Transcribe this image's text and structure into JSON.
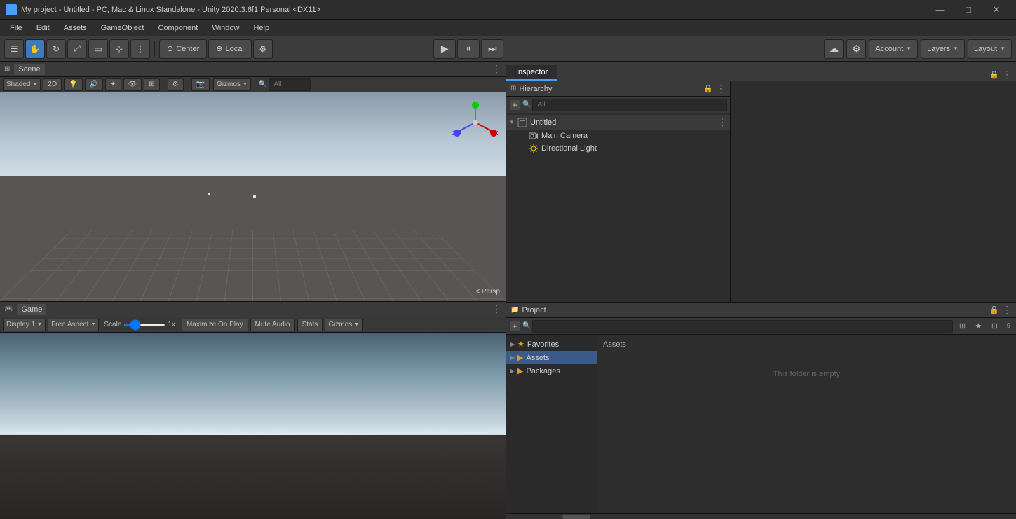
{
  "titlebar": {
    "title": "My project - Untitled - PC, Mac & Linux Standalone - Unity 2020.3.6f1 Personal <DX11>",
    "minimize": "—",
    "maximize": "□",
    "close": "✕"
  },
  "menubar": {
    "items": [
      "File",
      "Edit",
      "Assets",
      "GameObject",
      "Component",
      "Window",
      "Help"
    ]
  },
  "toolbar": {
    "tools": [
      "☰",
      "✋",
      "↔",
      "⤢",
      "⟳",
      "⚙",
      "🔧"
    ],
    "pivot_center": "Center",
    "pivot_local": "Local",
    "play": "▶",
    "pause": "⏸",
    "step": "⏭",
    "account_label": "Account",
    "layers_label": "Layers",
    "layout_label": "Layout"
  },
  "scene": {
    "tab_label": "Scene",
    "shading_label": "Shaded",
    "view_2d": "2D",
    "gizmos_label": "Gizmos",
    "search_placeholder": "All",
    "persp_label": "< Persp"
  },
  "game": {
    "tab_label": "Game",
    "display_label": "Display 1",
    "aspect_label": "Free Aspect",
    "scale_label": "Scale",
    "scale_value": "1x",
    "maximize_label": "Maximize On Play",
    "mute_label": "Mute Audio",
    "stats_label": "Stats",
    "gizmos_label": "Gizmos"
  },
  "hierarchy": {
    "tab_label": "Hierarchy",
    "search_placeholder": "All",
    "items": [
      {
        "name": "Untitled",
        "type": "scene",
        "level": 0,
        "has_arrow": true,
        "icon": "scene"
      },
      {
        "name": "Main Camera",
        "type": "camera",
        "level": 1,
        "has_arrow": false,
        "icon": "camera"
      },
      {
        "name": "Directional Light",
        "type": "light",
        "level": 1,
        "has_arrow": false,
        "icon": "light"
      }
    ]
  },
  "inspector": {
    "tab_label": "Inspector",
    "panel_label": "Inspector"
  },
  "project": {
    "tab_label": "Project",
    "search_placeholder": "",
    "sidebar": {
      "items": [
        {
          "name": "Favorites",
          "type": "favorites",
          "level": 0,
          "has_arrow": true
        },
        {
          "name": "Assets",
          "type": "folder",
          "level": 0,
          "has_arrow": true
        },
        {
          "name": "Packages",
          "type": "folder",
          "level": 0,
          "has_arrow": true
        }
      ]
    },
    "main_label": "Assets",
    "empty_text": "This folder is empty"
  },
  "colors": {
    "accent_blue": "#4a9eff",
    "folder_yellow": "#d4a027",
    "bg_dark": "#1e1e1e",
    "bg_panel": "#2d2d2d",
    "bg_toolbar": "#3a3a3a"
  }
}
